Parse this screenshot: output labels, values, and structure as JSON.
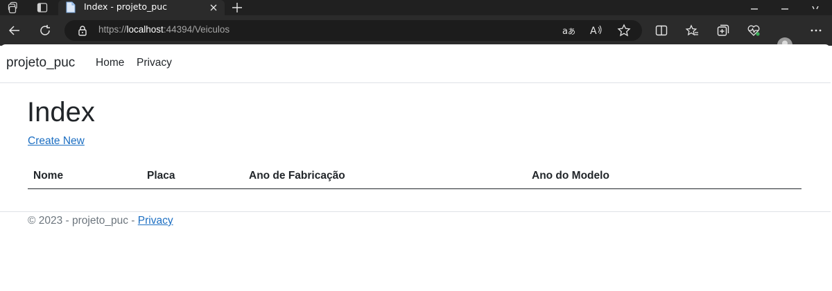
{
  "browser": {
    "tab": {
      "title": "Index - projeto_puc"
    },
    "url": {
      "scheme": "https://",
      "host": "localhost",
      "rest": ":44394/Veiculos"
    }
  },
  "navbar": {
    "brand": "projeto_puc",
    "links": [
      {
        "label": "Home"
      },
      {
        "label": "Privacy"
      }
    ]
  },
  "main": {
    "heading": "Index",
    "create_link": "Create New",
    "table": {
      "columns": [
        "Nome",
        "Placa",
        "Ano de Fabricação",
        "Ano do Modelo"
      ],
      "rows": []
    }
  },
  "footer": {
    "text": "© 2023 - projeto_puc - ",
    "privacy_link": "Privacy"
  },
  "colors": {
    "link": "#1b6ec2",
    "text": "#212529",
    "muted": "#6c757d",
    "chrome_dark": "#202020",
    "chrome_toolbar": "#2b2b2b"
  },
  "icons": [
    "workspaces-icon",
    "tab-actions-icon",
    "page-favicon-icon",
    "close-icon",
    "plus-icon",
    "minimize-icon",
    "maximize-icon",
    "back-icon",
    "refresh-icon",
    "lock-icon",
    "read-aloud-translate-icon",
    "read-aloud-icon",
    "favorite-star-icon",
    "split-screen-icon",
    "favorites-icon",
    "collections-icon",
    "browser-essentials-icon",
    "profile-avatar-icon",
    "more-menu-icon"
  ]
}
